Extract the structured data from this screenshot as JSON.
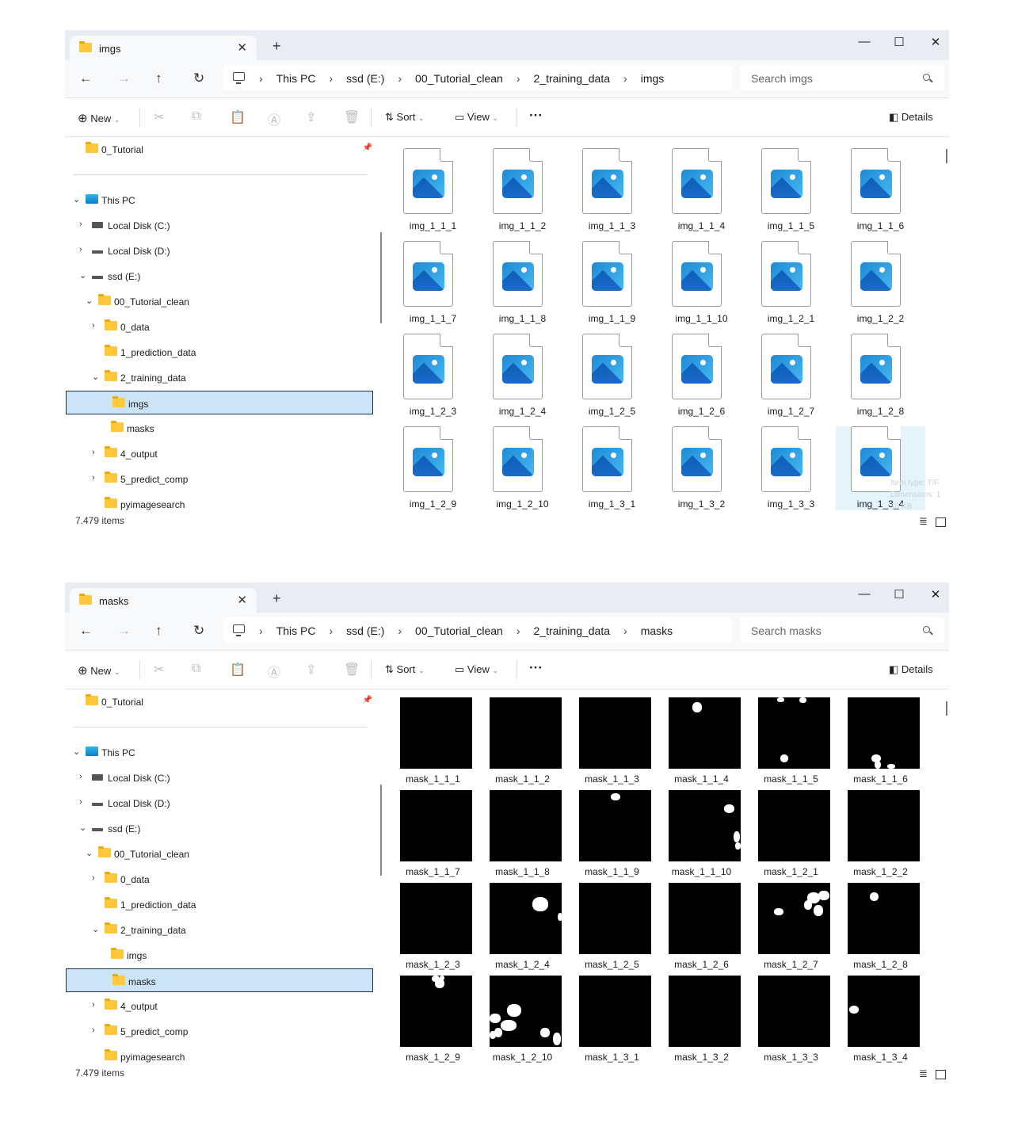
{
  "windows": [
    {
      "tab_title": "imgs",
      "breadcrumb": [
        "This PC",
        "ssd (E:)",
        "00_Tutorial_clean",
        "2_training_data",
        "imgs"
      ],
      "search_placeholder": "Search imgs",
      "toolbar": {
        "new_label": "New",
        "sort_label": "Sort",
        "view_label": "View",
        "details_label": "Details"
      },
      "sidebar": {
        "pinned": "0_Tutorial",
        "this_pc": "This PC",
        "local_c": "Local Disk (C:)",
        "local_d": "Local Disk (D:)",
        "ssd": "ssd (E:)",
        "tutorial_clean": "00_Tutorial_clean",
        "data0": "0_data",
        "prediction": "1_prediction_data",
        "training": "2_training_data",
        "imgs": "imgs",
        "masks": "masks",
        "output": "4_output",
        "predict_comp": "5_predict_comp",
        "pyimagesearch": "pyimagesearch"
      },
      "status": "7.479 items",
      "files": [
        "img_1_1_1",
        "img_1_1_2",
        "img_1_1_3",
        "img_1_1_4",
        "img_1_1_5",
        "img_1_1_6",
        "img_1_1_7",
        "img_1_1_8",
        "img_1_1_9",
        "img_1_1_10",
        "img_1_2_1",
        "img_1_2_2",
        "img_1_2_3",
        "img_1_2_4",
        "img_1_2_5",
        "img_1_2_6",
        "img_1_2_7",
        "img_1_2_8",
        "img_1_2_9",
        "img_1_2_10",
        "img_1_3_1",
        "img_1_3_2",
        "img_1_3_3",
        "img_1_3_4"
      ],
      "tooltip": [
        "Item type: TIF",
        "Dimensions: 1",
        "10 KB"
      ]
    },
    {
      "tab_title": "masks",
      "breadcrumb": [
        "This PC",
        "ssd (E:)",
        "00_Tutorial_clean",
        "2_training_data",
        "masks"
      ],
      "search_placeholder": "Search masks",
      "toolbar": {
        "new_label": "New",
        "sort_label": "Sort",
        "view_label": "View",
        "details_label": "Details"
      },
      "sidebar": {
        "pinned": "0_Tutorial",
        "this_pc": "This PC",
        "local_c": "Local Disk (C:)",
        "local_d": "Local Disk (D:)",
        "ssd": "ssd (E:)",
        "tutorial_clean": "00_Tutorial_clean",
        "data0": "0_data",
        "prediction": "1_prediction_data",
        "training": "2_training_data",
        "imgs": "imgs",
        "masks": "masks",
        "output": "4_output",
        "predict_comp": "5_predict_comp",
        "pyimagesearch": "pyimagesearch"
      },
      "status": "7.479 items",
      "files": [
        "mask_1_1_1",
        "mask_1_1_2",
        "mask_1_1_3",
        "mask_1_1_4",
        "mask_1_1_5",
        "mask_1_1_6",
        "mask_1_1_7",
        "mask_1_1_8",
        "mask_1_1_9",
        "mask_1_1_10",
        "mask_1_2_1",
        "mask_1_2_2",
        "mask_1_2_3",
        "mask_1_2_4",
        "mask_1_2_5",
        "mask_1_2_6",
        "mask_1_2_7",
        "mask_1_2_8",
        "mask_1_2_9",
        "mask_1_2_10",
        "mask_1_3_1",
        "mask_1_3_2",
        "mask_1_3_3",
        "mask_1_3_4"
      ]
    }
  ]
}
